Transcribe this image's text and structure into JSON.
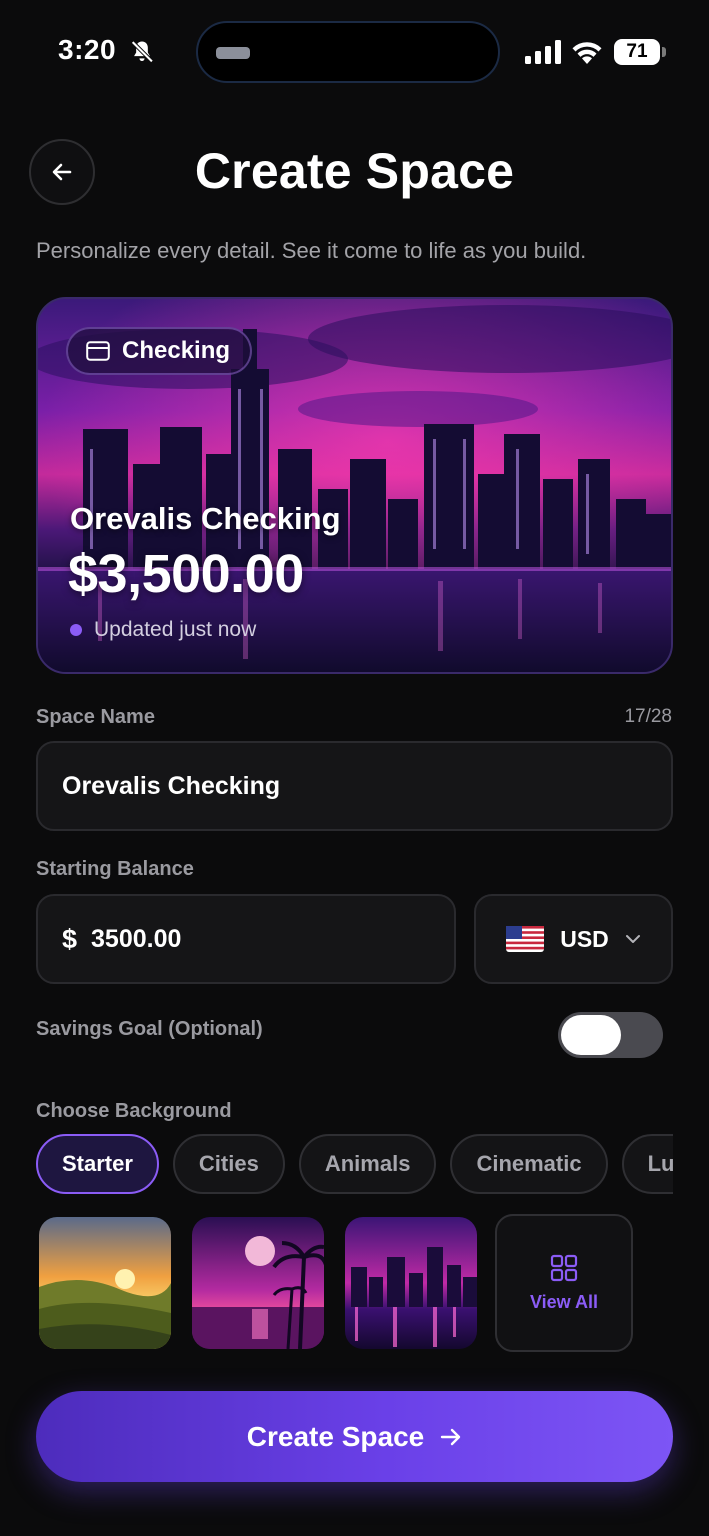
{
  "status_bar": {
    "time": "3:20",
    "battery": "71",
    "icons": [
      "bell-slash-icon",
      "signal-icon",
      "wifi-icon",
      "battery-icon"
    ]
  },
  "header": {
    "title": "Create Space",
    "subtitle": "Personalize every detail. See it come to life as you build.",
    "back_icon": "arrow-left-icon"
  },
  "preview_card": {
    "type_label": "Checking",
    "type_icon": "card-icon",
    "name": "Orevalis Checking",
    "balance": "$3,500.00",
    "updated": "Updated just now"
  },
  "form": {
    "space_name": {
      "label": "Space Name",
      "counter": "17/28",
      "value": "Orevalis Checking"
    },
    "starting_balance": {
      "label": "Starting Balance",
      "currency_symbol": "$",
      "value": "3500.00",
      "currency": "USD",
      "flag_icon": "us-flag-icon"
    },
    "savings_goal": {
      "label": "Savings Goal (Optional)",
      "enabled": false
    }
  },
  "background": {
    "label": "Choose Background",
    "categories": [
      "Starter",
      "Cities",
      "Animals",
      "Cinematic",
      "Luxury"
    ],
    "selected_category": "Starter",
    "thumbnails": [
      "sunset-meadow",
      "purple-moon-beach",
      "neon-city-night"
    ],
    "view_all_label": "View All",
    "view_all_icon": "grid-icon"
  },
  "cta": {
    "label": "Create Space",
    "icon": "arrow-right-icon"
  },
  "colors": {
    "accent": "#8b5cf6",
    "background": "#0b0b0c",
    "field": "#151517"
  }
}
